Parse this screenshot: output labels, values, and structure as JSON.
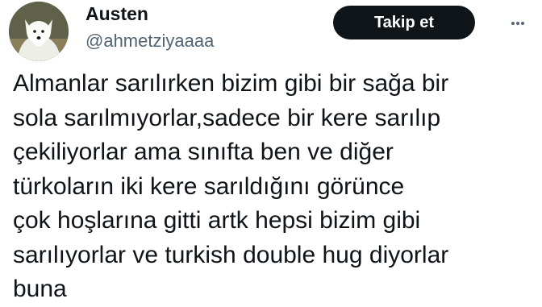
{
  "author": {
    "name": "Austen",
    "handle": "@ahmetziyaaaa",
    "avatar_icon": "white-dog-avatar"
  },
  "actions": {
    "follow_label": "Takip et",
    "more_icon": "more-options-icon"
  },
  "tweet": {
    "lines": [
      "Almanlar sarılırken bizim gibi bir sağa bir",
      "sola sarılmıyorlar,sadece bir kere sarılıp",
      "çekiliyorlar ama sınıfta ben ve diğer",
      "türkoların iki kere sarıldığını görünce",
      "çok hoşlarına gitti artk hepsi bizim gibi",
      "sarılıyorlar ve turkish double hug diyorlar",
      "buna"
    ]
  },
  "colors": {
    "background": "#ffffff",
    "text_primary": "#0f1419",
    "text_secondary": "#536471",
    "button_background": "#0f1419",
    "button_text": "#ffffff"
  }
}
